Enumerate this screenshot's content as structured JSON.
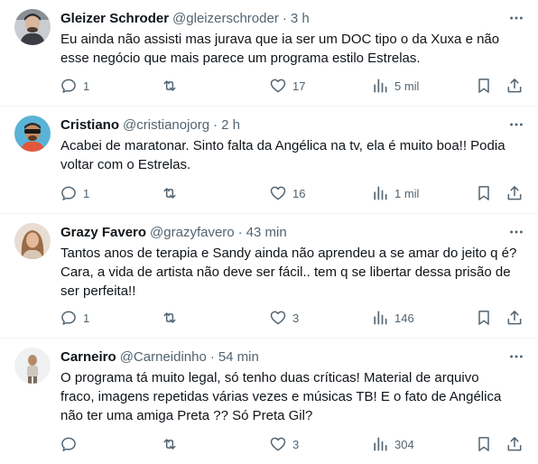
{
  "tweets": [
    {
      "name": "Gleizer Schroder",
      "handle": "@gleizerschroder",
      "sep": "·",
      "time": "3 h",
      "lines": [
        "Eu ainda não assisti mas jurava que ia ser um DOC tipo o da Xuxa e não",
        "esse negócio que mais parece um programa estilo Estrelas."
      ],
      "replies": "1",
      "retweets": "",
      "likes": "17",
      "views": "5 mil"
    },
    {
      "name": "Cristiano",
      "handle": "@cristianojorg",
      "sep": "·",
      "time": "2 h",
      "lines": [
        "Acabei de maratonar. Sinto falta da Angélica na tv, ela é muito boa!! Podia",
        "voltar com o Estrelas."
      ],
      "replies": "1",
      "retweets": "",
      "likes": "16",
      "views": "1 mil"
    },
    {
      "name": "Grazy Favero",
      "handle": "@grazyfavero",
      "sep": "·",
      "time": "43 min",
      "lines": [
        "Tantos anos de terapia e Sandy ainda não aprendeu a se amar do jeito q é?",
        "Cara, a vida de artista não deve ser fácil.. tem q se libertar dessa prisão de",
        "ser perfeita!!"
      ],
      "replies": "1",
      "retweets": "",
      "likes": "3",
      "views": "146"
    },
    {
      "name": "Carneiro",
      "handle": "@Carneidinho",
      "sep": "·",
      "time": "54 min",
      "lines": [
        "O programa tá muito legal, só tenho duas críticas! Material de arquivo",
        "fraco, imagens repetidas várias vezes  e músicas TB! E o fato de Angélica",
        "não ter uma amiga Preta ?? Só Preta Gil?"
      ],
      "replies": "",
      "retweets": "",
      "likes": "3",
      "views": "304"
    }
  ],
  "icons": {
    "reply": "reply-icon",
    "retweet": "retweet-icon",
    "like": "heart-icon",
    "views": "views-icon",
    "bookmark": "bookmark-icon",
    "share": "share-icon",
    "more": "more-icon"
  },
  "colors": {
    "text": "#0f1419",
    "secondary": "#536471",
    "divider": "#eff3f4"
  }
}
